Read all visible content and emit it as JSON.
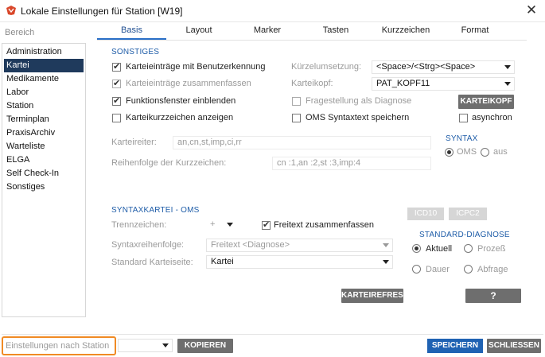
{
  "window": {
    "title": "Lokale Einstellungen für Station [W19]"
  },
  "sidebar": {
    "heading": "Bereich",
    "items": [
      {
        "label": "Administration"
      },
      {
        "label": "Kartei"
      },
      {
        "label": "Medikamente"
      },
      {
        "label": "Labor"
      },
      {
        "label": "Station"
      },
      {
        "label": "Terminplan"
      },
      {
        "label": "PraxisArchiv"
      },
      {
        "label": "Warteliste"
      },
      {
        "label": "ELGA"
      },
      {
        "label": "Self Check-In"
      },
      {
        "label": "Sonstiges"
      }
    ],
    "selected": "Kartei"
  },
  "tabs": [
    {
      "label": "Basis"
    },
    {
      "label": "Layout"
    },
    {
      "label": "Marker"
    },
    {
      "label": "Tasten"
    },
    {
      "label": "Kurzzeichen"
    },
    {
      "label": "Format"
    }
  ],
  "active_tab": "Basis",
  "sonstiges": {
    "heading": "SONSTIGES",
    "checkboxes": [
      {
        "label": "Karteieinträge mit Benutzerkennung",
        "checked": true
      },
      {
        "label": "Karteieinträge zusammenfassen",
        "checked": true
      },
      {
        "label": "Funktionsfenster einblenden",
        "checked": true
      },
      {
        "label": "Karteikurzzeichen anzeigen",
        "checked": false
      }
    ],
    "kuerzelumsetzung_label": "Kürzelumsetzung:",
    "kuerzelumsetzung_value": "<Space>/<Strg><Space>",
    "karteikopf_label": "Karteikopf:",
    "karteikopf_value": "PAT_KOPF11",
    "fragestellung_label": "Fragestellung als Diagnose",
    "fragestellung_checked": false,
    "oms_label": "OMS Syntaxtext speichern",
    "oms_checked": false,
    "asynchron_label": "asynchron",
    "asynchron_checked": false,
    "karteikopf_button": "KARTEIKOPF",
    "karteireiter_label": "Karteireiter:",
    "karteireiter_value": "an,cn,st,imp,ci,rr",
    "reihenfolge_label": "Reihenfolge der Kurzzeichen:",
    "reihenfolge_value": "cn :1,an :2,st :3,imp:4",
    "syntax_heading": "SYNTAX",
    "syntax_options": [
      {
        "label": "OMS",
        "selected": true
      },
      {
        "label": "aus",
        "selected": false
      }
    ]
  },
  "syntaxkartei": {
    "heading": "SYNTAXKARTEI - OMS",
    "trennzeichen_label": "Trennzeichen:",
    "trennzeichen_value": "+",
    "freitext_label": "Freitext zusammenfassen",
    "freitext_checked": true,
    "icd10_button": "ICD10",
    "icpc2_button": "ICPC2",
    "syntaxreihenfolge_label": "Syntaxreihenfolge:",
    "syntaxreihenfolge_value": "Freitext <Diagnose>",
    "standard_karteiseite_label": "Standard Karteiseite:",
    "standard_karteiseite_value": "Kartei",
    "standard_diagnose_heading": "STANDARD-DIAGNOSE",
    "diagnose_options": [
      {
        "label": "Aktuell",
        "selected": true
      },
      {
        "label": "Prozeß",
        "selected": false
      },
      {
        "label": "Dauer",
        "selected": false
      },
      {
        "label": "Abfrage",
        "selected": false
      }
    ],
    "karteirefresh_button": "KARTEIREFRESH",
    "help_button": "?"
  },
  "footer": {
    "station_label": "Einstellungen nach Station",
    "station_value": "",
    "kopieren_button": "KOPIEREN",
    "speichern_button": "SPEICHERN",
    "schliessen_button": "SCHLIESSEN"
  },
  "colors": {
    "accent": "#1f62b3",
    "highlight": "#f08a24",
    "sidebar_active": "#1f3a5c"
  },
  "icons": {
    "app": "app-logo-icon",
    "close": "close-icon"
  }
}
